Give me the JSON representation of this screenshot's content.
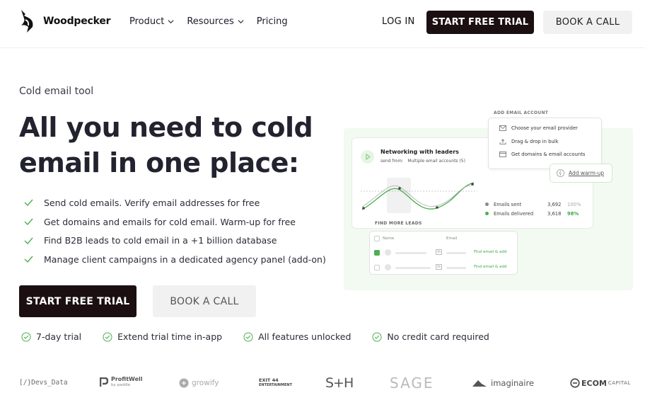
{
  "nav": {
    "brand": "Woodpecker",
    "menu": [
      {
        "label": "Product",
        "dropdown": true
      },
      {
        "label": "Resources",
        "dropdown": true
      },
      {
        "label": "Pricing",
        "dropdown": false
      }
    ],
    "login": "LOG IN",
    "trial": "START FREE TRIAL",
    "call": "BOOK A CALL"
  },
  "hero": {
    "eyebrow": "Cold email tool",
    "headline": "All you need to cold email in one place:",
    "features": [
      "Send cold emails. Verify email addresses for free",
      "Get domains and emails for cold email. Warm-up for free",
      "Find B2B leads to cold email in a +1 billion database",
      "Manage client campaigns in a dedicated agency panel (add-on)"
    ],
    "cta_trial": "START FREE TRIAL",
    "cta_call": "BOOK A CALL",
    "perks": [
      "7-day trial",
      "Extend trial time in-app",
      "All features unlocked",
      "No credit card required"
    ]
  },
  "illustration": {
    "campaign_title": "Networking with leaders",
    "send_from_label": "send from:",
    "send_from_value": "Multiple email accounts (5)",
    "stats": [
      {
        "label": "Emails sent",
        "value": "3,692",
        "pct": "100%",
        "color": "#888888"
      },
      {
        "label": "Emails delivered",
        "value": "3,618",
        "pct": "98%",
        "color": "#4caf50"
      }
    ],
    "add_account_title": "ADD EMAIL ACCOUNT",
    "add_account_options": [
      "Choose your email provider",
      "Drag & drop in bulk",
      "Get domains & email accounts"
    ],
    "warmup": "Add warm-up",
    "find_leads_title": "FIND MORE LEADS",
    "leads_headers": [
      "Name",
      "Email"
    ],
    "leads_action": "Find email & add",
    "leads_rows": [
      {
        "checked": true
      },
      {
        "checked": false
      }
    ]
  },
  "logos": [
    {
      "name": "Devs_Data",
      "text": "[/}Devs_Data"
    },
    {
      "name": "ProfitWell",
      "text": "ProfitWell",
      "sub": "by paddle"
    },
    {
      "name": "growify",
      "text": "growify"
    },
    {
      "name": "exit44",
      "text": "EXIT 44",
      "sub": "ENTERTAINMENT"
    },
    {
      "name": "sh",
      "text": "S+H"
    },
    {
      "name": "sage",
      "text": "SAGE"
    },
    {
      "name": "imaginaire",
      "text": "imaginaire"
    },
    {
      "name": "ecom",
      "text": "ECOM",
      "sub": "CAPITAL"
    }
  ],
  "colors": {
    "accent": "#1c0f12",
    "green": "#4caf50",
    "mint": "#f2faf1"
  }
}
